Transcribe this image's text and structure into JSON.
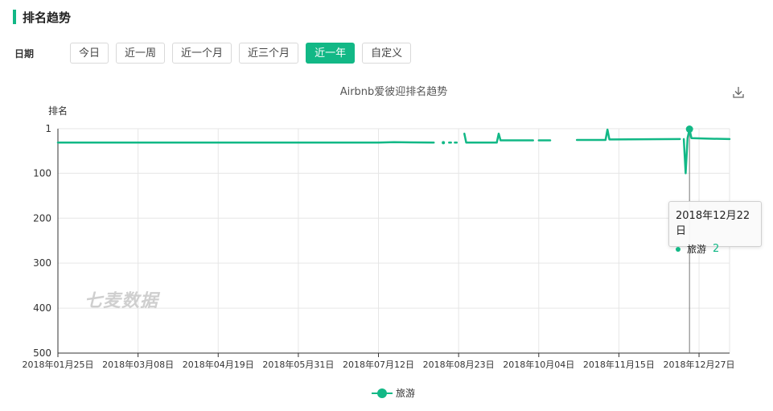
{
  "section": {
    "title": "排名趋势"
  },
  "filter": {
    "label": "日期",
    "buttons": [
      "今日",
      "近一周",
      "近一个月",
      "近三个月",
      "近一年",
      "自定义"
    ],
    "active_index": 4
  },
  "chart_data": {
    "type": "line",
    "title": "Airbnb爱彼迎排名趋势",
    "ylabel": "排名",
    "y_inverted": true,
    "ylim": [
      1,
      500
    ],
    "yticks": [
      "1",
      "100",
      "200",
      "300",
      "400",
      "500"
    ],
    "xlim": [
      "2018-01-25",
      "2019-01-12"
    ],
    "xticks": [
      "2018年01月25日",
      "2018年03月08日",
      "2018年04月19日",
      "2018年05月31日",
      "2018年07月12日",
      "2018年08月23日",
      "2018年10月04日",
      "2018年11月15日",
      "2018年12月27日"
    ],
    "grid": true,
    "legend_position": "bottom-center",
    "series": [
      {
        "name": "旅游",
        "color": "#12b886",
        "segments": [
          [
            [
              "2018-01-25",
              32
            ],
            [
              "2018-07-12",
              32
            ],
            [
              "2018-07-20",
              31
            ],
            [
              "2018-08-10",
              32
            ]
          ],
          [
            [
              "2018-08-15",
              32
            ]
          ],
          [
            [
              "2018-08-18",
              32
            ],
            [
              "2018-08-19",
              32
            ]
          ],
          [
            [
              "2018-08-21",
              32
            ],
            [
              "2018-08-22",
              32
            ]
          ],
          [
            [
              "2018-08-26",
              12
            ],
            [
              "2018-08-27",
              32
            ],
            [
              "2018-09-12",
              32
            ],
            [
              "2018-09-13",
              12
            ],
            [
              "2018-09-14",
              27
            ],
            [
              "2018-10-01",
              27
            ]
          ],
          [
            [
              "2018-10-04",
              27
            ],
            [
              "2018-10-10",
              27
            ]
          ],
          [
            [
              "2018-10-24",
              26
            ],
            [
              "2018-11-08",
              26
            ],
            [
              "2018-11-09",
              3
            ],
            [
              "2018-11-10",
              25
            ],
            [
              "2018-12-17",
              24
            ]
          ],
          [
            [
              "2018-12-19",
              24
            ],
            [
              "2018-12-20",
              100
            ],
            [
              "2018-12-21",
              22
            ],
            [
              "2018-12-22",
              2
            ],
            [
              "2018-12-23",
              22
            ],
            [
              "2018-12-30",
              23
            ],
            [
              "2019-01-12",
              24
            ]
          ]
        ]
      }
    ],
    "watermark": "七麦数据"
  },
  "tooltip": {
    "date": "2018年12月22日",
    "series": "旅游",
    "value": "2"
  },
  "colors": {
    "accent": "#12b886",
    "grid": "#e6e6e6",
    "axis": "#333333"
  }
}
